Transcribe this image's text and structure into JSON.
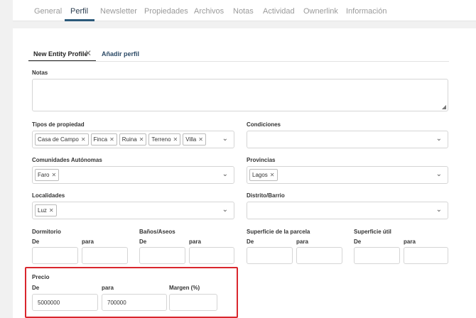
{
  "top_tabs": [
    "General",
    "Perfil",
    "Newsletter",
    "Propiedades",
    "Archivos",
    "Notas",
    "Actividad",
    "Ownerlink",
    "Información"
  ],
  "profile_tabs": {
    "active": "New Entity Profile",
    "close": "✕",
    "add": "Añadir perfil"
  },
  "form": {
    "notas": "Notas",
    "tipos": {
      "label": "Tipos de propiedad",
      "chips": [
        "Casa de Campo",
        "Finca",
        "Ruina",
        "Terreno",
        "Villa"
      ]
    },
    "condiciones": {
      "label": "Condiciones"
    },
    "comunidades": {
      "label": "Comunidades Autónomas",
      "chips": [
        "Faro"
      ]
    },
    "provincias": {
      "label": "Provincias",
      "chips": [
        "Lagos"
      ]
    },
    "localidades": {
      "label": "Localidades",
      "chips": [
        "Luz"
      ]
    },
    "distrito": {
      "label": "Distrito/Barrio"
    },
    "dormitorio": "Dormitorio",
    "banos": "Baños/Aseos",
    "superficie_parcela": "Superficie de la parcela",
    "superficie_util": "Superficie útil",
    "de": "De",
    "para": "para",
    "precio": {
      "label": "Precio",
      "de": "De",
      "para": "para",
      "margen": "Margen (%)",
      "de_value": "5000000",
      "para_value": "700000",
      "margen_value": ""
    }
  },
  "icons": {
    "chevron": "chevron-down-icon",
    "chip_remove": "close-icon"
  },
  "colors": {
    "highlight": "#d9262d",
    "active_tab": "#2c5a7a"
  }
}
